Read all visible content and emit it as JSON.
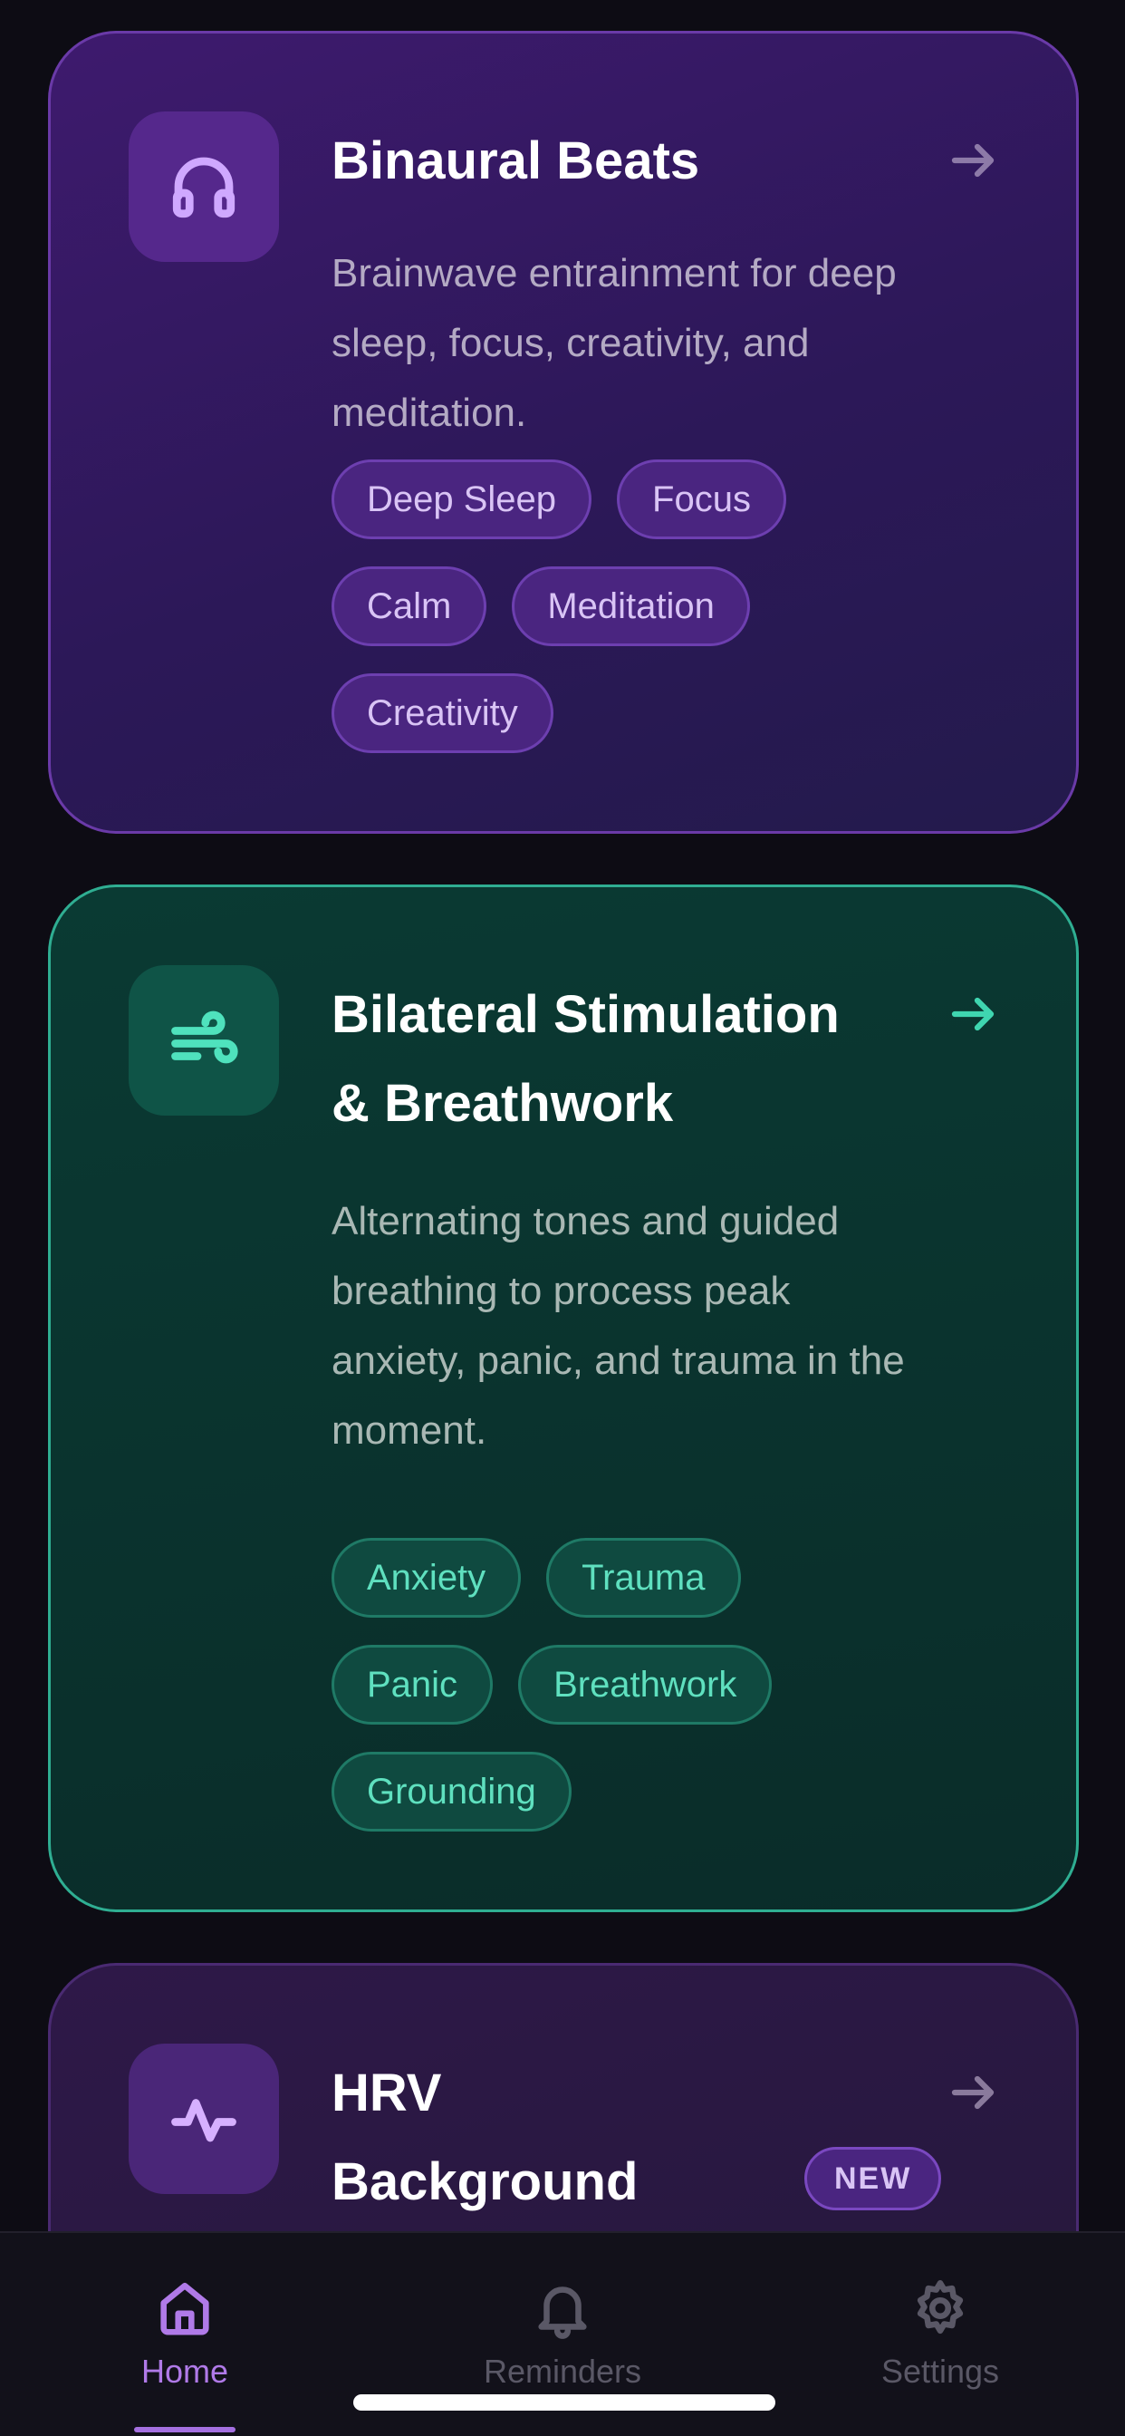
{
  "cards": [
    {
      "icon": "headphones-icon",
      "title": "Binaural Beats",
      "description": "Brainwave entrainment for deep sleep, focus, creativity, and meditation.",
      "tags": [
        "Deep Sleep",
        "Focus",
        "Calm",
        "Meditation",
        "Creativity"
      ],
      "accent": "#cfa8ff"
    },
    {
      "icon": "wind-icon",
      "title_line1": "Bilateral Stimulation",
      "title_line2": "& Breathwork",
      "description": "Alternating tones and guided breathing to process peak anxiety, panic, and trauma in the moment.",
      "tags": [
        "Anxiety",
        "Trauma",
        "Panic",
        "Breathwork",
        "Grounding"
      ],
      "accent": "#4fe2bd"
    },
    {
      "icon": "pulse-icon",
      "title_line1": "HRV",
      "title_line2": "Background",
      "badge": "NEW",
      "accent": "#d6b0ff"
    }
  ],
  "tabbar": {
    "tabs": [
      {
        "label": "Home",
        "icon": "home-icon",
        "active": true
      },
      {
        "label": "Reminders",
        "icon": "bell-icon",
        "active": false
      },
      {
        "label": "Settings",
        "icon": "gear-icon",
        "active": false
      }
    ]
  },
  "colors": {
    "background": "#0d0c14",
    "active_tab": "#b07ae8",
    "inactive_tab": "#5a5866"
  }
}
